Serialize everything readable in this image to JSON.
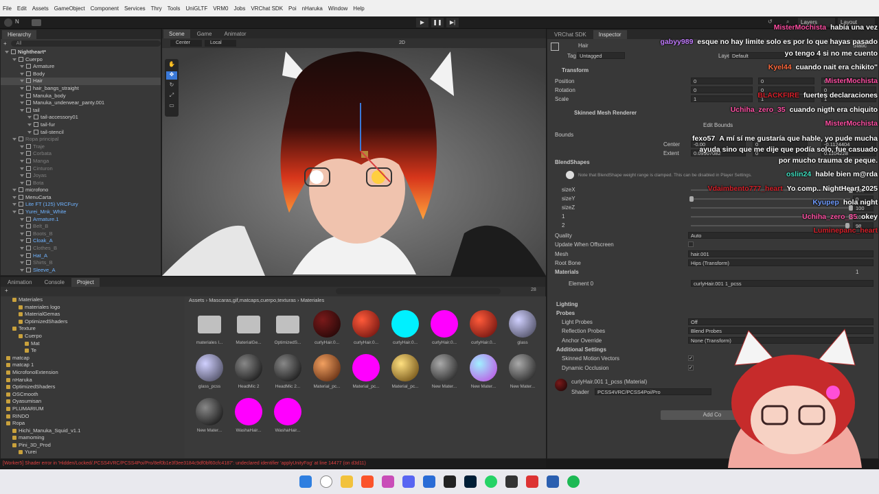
{
  "menubar": {
    "items": [
      "File",
      "Edit",
      "Assets",
      "GameObject",
      "Component",
      "Services",
      "Thry",
      "Tools",
      "UniGLTF",
      "VRM0",
      "Jobs",
      "VRChat SDK",
      "Poi",
      "nHaruka",
      "Window",
      "Help"
    ]
  },
  "toolbar": {
    "account": "N",
    "layers": "Layers",
    "layout": "Layout"
  },
  "hierarchy": {
    "tab": "Hierarchy",
    "search": "All",
    "rows": [
      {
        "t": "Nightheart*",
        "d": 0,
        "c": "bold"
      },
      {
        "t": "Cuerpo",
        "d": 1
      },
      {
        "t": "Armature",
        "d": 2
      },
      {
        "t": "Body",
        "d": 2
      },
      {
        "t": "Hair",
        "d": 2,
        "c": "sel"
      },
      {
        "t": "hair_bangs_straight",
        "d": 2
      },
      {
        "t": "Manuka_body",
        "d": 2
      },
      {
        "t": "Manuka_underwear_panty.001",
        "d": 2
      },
      {
        "t": "tail",
        "d": 2
      },
      {
        "t": "tail-accessory01",
        "d": 3
      },
      {
        "t": "tail-fur",
        "d": 3
      },
      {
        "t": "tail-stencil",
        "d": 3
      },
      {
        "t": "Ropa principal",
        "d": 1,
        "c": "dim"
      },
      {
        "t": "Traje",
        "d": 2,
        "c": "dim"
      },
      {
        "t": "Corbata",
        "d": 2,
        "c": "dim"
      },
      {
        "t": "Manga",
        "d": 2,
        "c": "dim"
      },
      {
        "t": "Cinturon",
        "d": 2,
        "c": "dim"
      },
      {
        "t": "Joyas",
        "d": 2,
        "c": "dim"
      },
      {
        "t": "Bota",
        "d": 2,
        "c": "dim"
      },
      {
        "t": "microfono",
        "d": 1
      },
      {
        "t": "MenuCarta",
        "d": 1
      },
      {
        "t": "Lite FT (125) VRCFury",
        "d": 1,
        "c": "blue"
      },
      {
        "t": "Yurei_Mnk_White",
        "d": 1,
        "c": "blue"
      },
      {
        "t": "Armature.1",
        "d": 2,
        "c": "blue"
      },
      {
        "t": "Belt_B",
        "d": 2,
        "c": "dim"
      },
      {
        "t": "Boots_B",
        "d": 2,
        "c": "dim"
      },
      {
        "t": "Cloak_A",
        "d": 2,
        "c": "blue"
      },
      {
        "t": "Clothes_B",
        "d": 2,
        "c": "dim"
      },
      {
        "t": "Hat_A",
        "d": 2,
        "c": "blue"
      },
      {
        "t": "Shirts_B",
        "d": 2,
        "c": "dim"
      },
      {
        "t": "Sleeve_A",
        "d": 2,
        "c": "blue"
      }
    ]
  },
  "scene": {
    "tabs": [
      "Scene",
      "Game",
      "Animator"
    ],
    "pivot": "Center",
    "space": "Local",
    "mode2d": "2D"
  },
  "bottom": {
    "tabs": [
      "Animation",
      "Console",
      "Project"
    ],
    "count": "28",
    "breadcrumb": [
      "Assets",
      "Mascaras,gif,matcaps,cuerpo,texturas",
      "Materiales"
    ],
    "tree": [
      {
        "t": "Materiales",
        "d": 1
      },
      {
        "t": "materiales logo",
        "d": 2
      },
      {
        "t": "MaterialGemas",
        "d": 2
      },
      {
        "t": "OptimizedShaders",
        "d": 2
      },
      {
        "t": "Texture",
        "d": 1
      },
      {
        "t": "Cuerpo",
        "d": 2
      },
      {
        "t": "Mat",
        "d": 3
      },
      {
        "t": "Te",
        "d": 3
      },
      {
        "t": "matcap",
        "d": 0
      },
      {
        "t": "matcap 1",
        "d": 0
      },
      {
        "t": "MicrofonoExtension",
        "d": 0
      },
      {
        "t": "nHaruka",
        "d": 0
      },
      {
        "t": "OptimizedShaders",
        "d": 0
      },
      {
        "t": "OSCmooth",
        "d": 0
      },
      {
        "t": "Oyasumisan",
        "d": 0
      },
      {
        "t": "PLUMARIUM",
        "d": 0
      },
      {
        "t": "RINDO",
        "d": 0
      },
      {
        "t": "Ropa",
        "d": 0
      },
      {
        "t": "Hichi_Manuka_Squid_v1.1",
        "d": 1
      },
      {
        "t": "mamoming",
        "d": 1
      },
      {
        "t": "Pini_3D_Prod",
        "d": 1
      },
      {
        "t": "Yurei",
        "d": 2
      }
    ],
    "assets": [
      {
        "name": "materiales l...",
        "kind": "folder"
      },
      {
        "name": "MaterialGe...",
        "kind": "folder"
      },
      {
        "name": "OptimizedS...",
        "kind": "folder"
      },
      {
        "name": "curlyHair.0...",
        "kind": "dark"
      },
      {
        "name": "curlyHair.0...",
        "kind": "red"
      },
      {
        "name": "curlyHair.0...",
        "kind": "cyan"
      },
      {
        "name": "curlyHair.0...",
        "kind": "magenta"
      },
      {
        "name": "curlyHair.0...",
        "kind": "red"
      },
      {
        "name": "glass",
        "kind": "glass"
      },
      {
        "name": "glass_pcss",
        "kind": "glass"
      },
      {
        "name": "HeadMic 2",
        "kind": "black"
      },
      {
        "name": "HeadMic 2...",
        "kind": "black"
      },
      {
        "name": "Material_pc...",
        "kind": "copper"
      },
      {
        "name": "Material_pc...",
        "kind": "magenta"
      },
      {
        "name": "Material_pc...",
        "kind": "gold"
      },
      {
        "name": "New Mater...",
        "kind": "grey"
      },
      {
        "name": "New Mater...",
        "kind": "holo"
      },
      {
        "name": "New Mater...",
        "kind": "grey"
      },
      {
        "name": "New Mater...",
        "kind": "black"
      },
      {
        "name": "WashaHair...",
        "kind": "magenta"
      },
      {
        "name": "WashaHair...",
        "kind": "magenta"
      }
    ]
  },
  "status": "[Worker5] Shader error in 'Hidden/Locked/.PCSS4VRC/PCSS4Poi/Pro/8ef0b1e3f3ee3184c9df0bf60cfc4187': undeclared identifier 'applyUnityFog' at line 14477 (on d3d11)",
  "inspector": {
    "tabs": [
      "VRChat SDK",
      "Inspector"
    ],
    "object": "Hair",
    "static": "Static",
    "tag_label": "Tag",
    "tag": "Untagged",
    "layer_label": "Layer",
    "layer": "Default",
    "transform": "Transform",
    "position": "Position",
    "rotation": "Rotation",
    "scale": "Scale",
    "pos": [
      "0",
      "0",
      "0"
    ],
    "rot": [
      "0",
      "0",
      "0"
    ],
    "scl": [
      "1",
      "1",
      "1"
    ],
    "smr": "Skinned Mesh Renderer",
    "bounds": "Bounds",
    "center": "Center",
    "extent": "Extent",
    "edit_bounds": "Edit Bounds",
    "center_vals": [
      "-0.00",
      "0",
      "-0.1124404"
    ],
    "extent_vals": [
      "0.09907082",
      "0",
      "0.1104228"
    ],
    "blendshapes": "BlendShapes",
    "bs_note": "Note that BlendShape weight range is clamped. This can be disabled in Player Settings.",
    "bs": [
      {
        "n": "sizeX",
        "v": "100"
      },
      {
        "n": "sizeY",
        "v": "0"
      },
      {
        "n": "sizeZ",
        "v": "100"
      },
      {
        "n": "1",
        "v": "100"
      },
      {
        "n": "2",
        "v": "98"
      }
    ],
    "quality": "Quality",
    "quality_v": "Auto",
    "update_off": "Update When Offscreen",
    "mesh": "Mesh",
    "mesh_v": "hair.001",
    "rootbone": "Root Bone",
    "rootbone_v": "Hips (Transform)",
    "materials": "Materials",
    "mat_count": "1",
    "element0": "Element 0",
    "element0_v": "curlyHair.001 1_pcss",
    "lighting": "Lighting",
    "probes": "Probes",
    "light_probes": "Light Probes",
    "light_probes_v": "Off",
    "refl": "Reflection Probes",
    "refl_v": "Blend Probes",
    "anchor": "Anchor Override",
    "anchor_v": "None (Transform)",
    "additional": "Additional Settings",
    "smv": "Skinned Motion Vectors",
    "dyn": "Dynamic Occlusion",
    "material_name": "curlyHair.001 1_pcss (Material)",
    "shader_label": "Shader",
    "shader": "PCSS4VRC/PCSS4Poi/Pro",
    "add_component": "Add Co"
  },
  "chat": [
    {
      "user": "MisterMochista",
      "color": "#ff4fa3",
      "msg": "había una vez"
    },
    {
      "user": "gabyy989",
      "color": "#c27cff",
      "msg": "esque no hay limite solo es por lo que hayas pasado"
    },
    {
      "user": "",
      "color": "#ffffff",
      "msg": "yo tengo 4 si no me cuento"
    },
    {
      "user": "Kyel44",
      "color": "#ff6a3d",
      "msg": "cuando nait era chikito\""
    },
    {
      "user": "MisterMochista",
      "color": "#ff4fa3",
      "msg": ""
    },
    {
      "user": "BLACKFIRE",
      "color": "#d4202a",
      "msg": "fuertes declaraciones"
    },
    {
      "user": "Uchiha_zero_35",
      "color": "#ff4fa3",
      "msg": "cuando nigth era chiquito"
    },
    {
      "user": "MisterMochista",
      "color": "#ff4fa3",
      "msg": ""
    },
    {
      "user": "fexo57",
      "color": "#ffffff",
      "msg": "A mí sí me gustaría que hable, yo pude mucha"
    },
    {
      "user": "",
      "color": "#ffffff",
      "msg": "ayuda sino que me dije que podía solo, fue casuado"
    },
    {
      "user": "",
      "color": "#ffffff",
      "msg": "por mucho trauma de peque."
    },
    {
      "user": "oslin24",
      "color": "#3ee0c0",
      "msg": "hable bien m@rda"
    },
    {
      "user": "Vdaimbento777_heart",
      "color": "#d4202a",
      "msg": "Yo comp.. NightHeart 2025"
    },
    {
      "user": "Kyupep",
      "color": "#6f9bff",
      "msg": "hola night"
    },
    {
      "user": "Uchiha_zero_35",
      "color": "#ff4fa3",
      "msg": "okey"
    },
    {
      "user": "Luminepanc_heart",
      "color": "#d4202a",
      "msg": ""
    }
  ],
  "colors": {
    "accent": "#3a79d8",
    "panel": "#383838",
    "dark": "#282828"
  }
}
